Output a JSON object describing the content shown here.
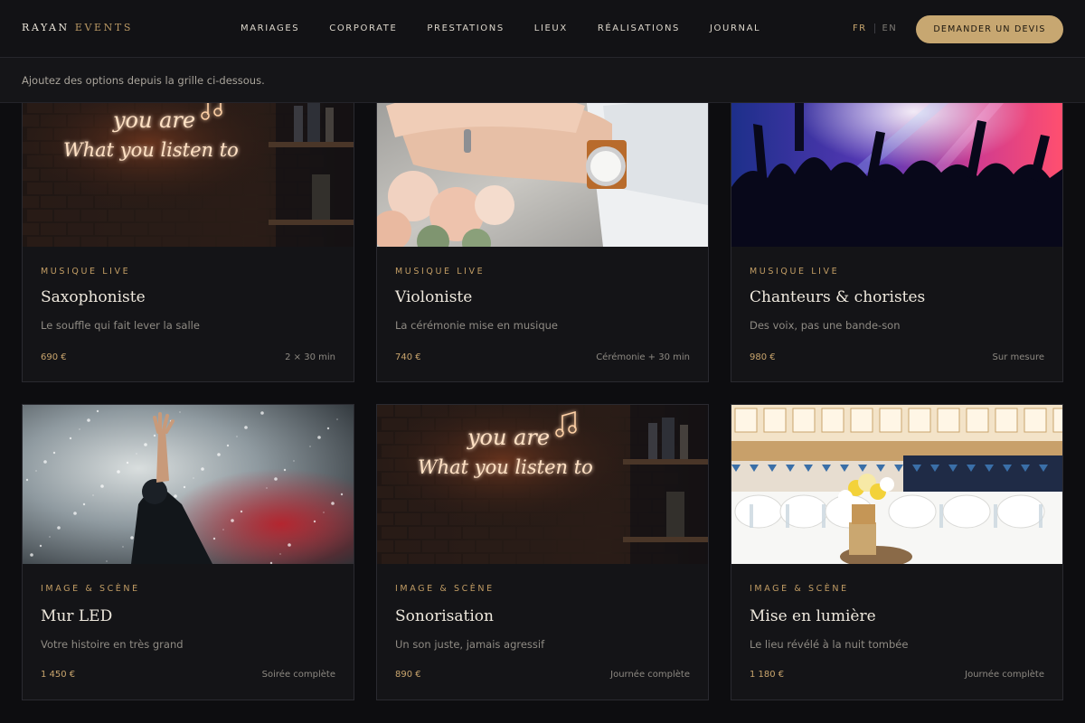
{
  "brand": {
    "name_primary": "RAYAN",
    "name_secondary": "EVENTS"
  },
  "nav": {
    "items": [
      "MARIAGES",
      "CORPORATE",
      "PRESTATIONS",
      "LIEUX",
      "RÉALISATIONS",
      "JOURNAL"
    ]
  },
  "lang": {
    "fr": "FR",
    "en": "EN",
    "active": "FR"
  },
  "cta": {
    "label": "DEMANDER UN DEVIS"
  },
  "infobar": {
    "text": "Ajoutez des options depuis la grille ci-dessous."
  },
  "colors": {
    "accent": "#c7a771",
    "background": "#0d0d10",
    "card": "#141417"
  },
  "cards": [
    {
      "category": "MUSIQUE LIVE",
      "title": "Saxophoniste",
      "description": "Le souffle qui fait lever la salle",
      "price": "690 €",
      "duration": "2 × 30 min",
      "image": "neon-sign",
      "neon_line1": "you are",
      "neon_line2": "What you listen to"
    },
    {
      "category": "MUSIQUE LIVE",
      "title": "Violoniste",
      "description": "La cérémonie mise en musique",
      "price": "740 €",
      "duration": "Cérémonie + 30 min",
      "image": "wedding-hands"
    },
    {
      "category": "MUSIQUE LIVE",
      "title": "Chanteurs & choristes",
      "description": "Des voix, pas une bande-son",
      "price": "980 €",
      "duration": "Sur mesure",
      "image": "concert-crowd"
    },
    {
      "category": "IMAGE & SCÈNE",
      "title": "Mur LED",
      "description": "Votre histoire en très grand",
      "price": "1 450 €",
      "duration": "Soirée complète",
      "image": "singer-smoke"
    },
    {
      "category": "IMAGE & SCÈNE",
      "title": "Sonorisation",
      "description": "Un son juste, jamais agressif",
      "price": "890 €",
      "duration": "Journée complète",
      "image": "neon-sign",
      "neon_line1": "you are",
      "neon_line2": "What you listen to"
    },
    {
      "category": "IMAGE & SCÈNE",
      "title": "Mise en lumière",
      "description": "Le lieu révélé à la nuit tombée",
      "price": "1 180 €",
      "duration": "Journée complète",
      "image": "banquet-hall"
    }
  ]
}
